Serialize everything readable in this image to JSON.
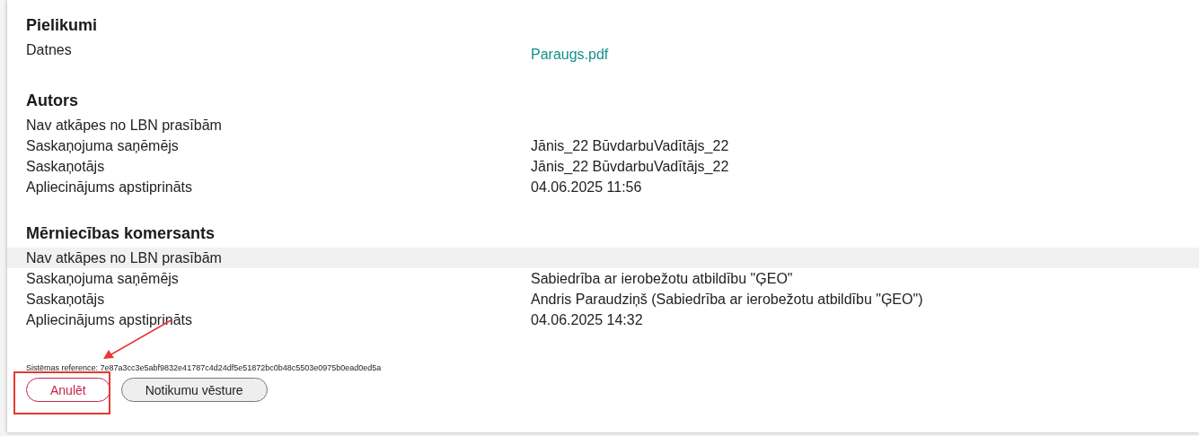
{
  "sections": [
    {
      "title": "Pielikumi",
      "rows": [
        {
          "label": "Datnes",
          "value": "Paraugs.pdf",
          "kind": "link",
          "highlighted": false
        }
      ]
    },
    {
      "title": "Autors",
      "rows": [
        {
          "label": "Nav atkāpes no LBN prasībām",
          "highlighted": false
        },
        {
          "label": "Saskaņojuma saņēmējs",
          "value": "Jānis_22 BūvdarbuVadītājs_22",
          "kind": "text",
          "highlighted": false
        },
        {
          "label": "Saskaņotājs",
          "value": "Jānis_22 BūvdarbuVadītājs_22",
          "kind": "text",
          "highlighted": false
        },
        {
          "label": "Apliecinājums apstiprināts",
          "value": "04.06.2025 11:56",
          "kind": "text",
          "highlighted": false
        }
      ]
    },
    {
      "title": "Mērniecības komersants",
      "rows": [
        {
          "label": "Nav atkāpes no LBN prasībām",
          "highlighted": true
        },
        {
          "label": "Saskaņojuma saņēmējs",
          "value": "Sabiedrība ar ierobežotu atbildību \"ĢEO\"",
          "kind": "text",
          "highlighted": false
        },
        {
          "label": "Saskaņotājs",
          "value": "Andris Paraudziņš (Sabiedrība ar ierobežotu atbildību \"ĢEO\")",
          "kind": "text",
          "highlighted": false
        },
        {
          "label": "Apliecinājums apstiprināts",
          "value": "04.06.2025 14:32",
          "kind": "text",
          "highlighted": false
        }
      ]
    }
  ],
  "reference": "Sistēmas reference: 7e87a3cc3e5abf9832e41787c4d24df5e51872bc0b48c5503e0975b0ead0ed5a",
  "buttons": [
    {
      "label": "Anulēt",
      "kind": "danger",
      "highlighted": true
    },
    {
      "label": "Notikumu vēsture",
      "kind": "default",
      "highlighted": false
    }
  ]
}
